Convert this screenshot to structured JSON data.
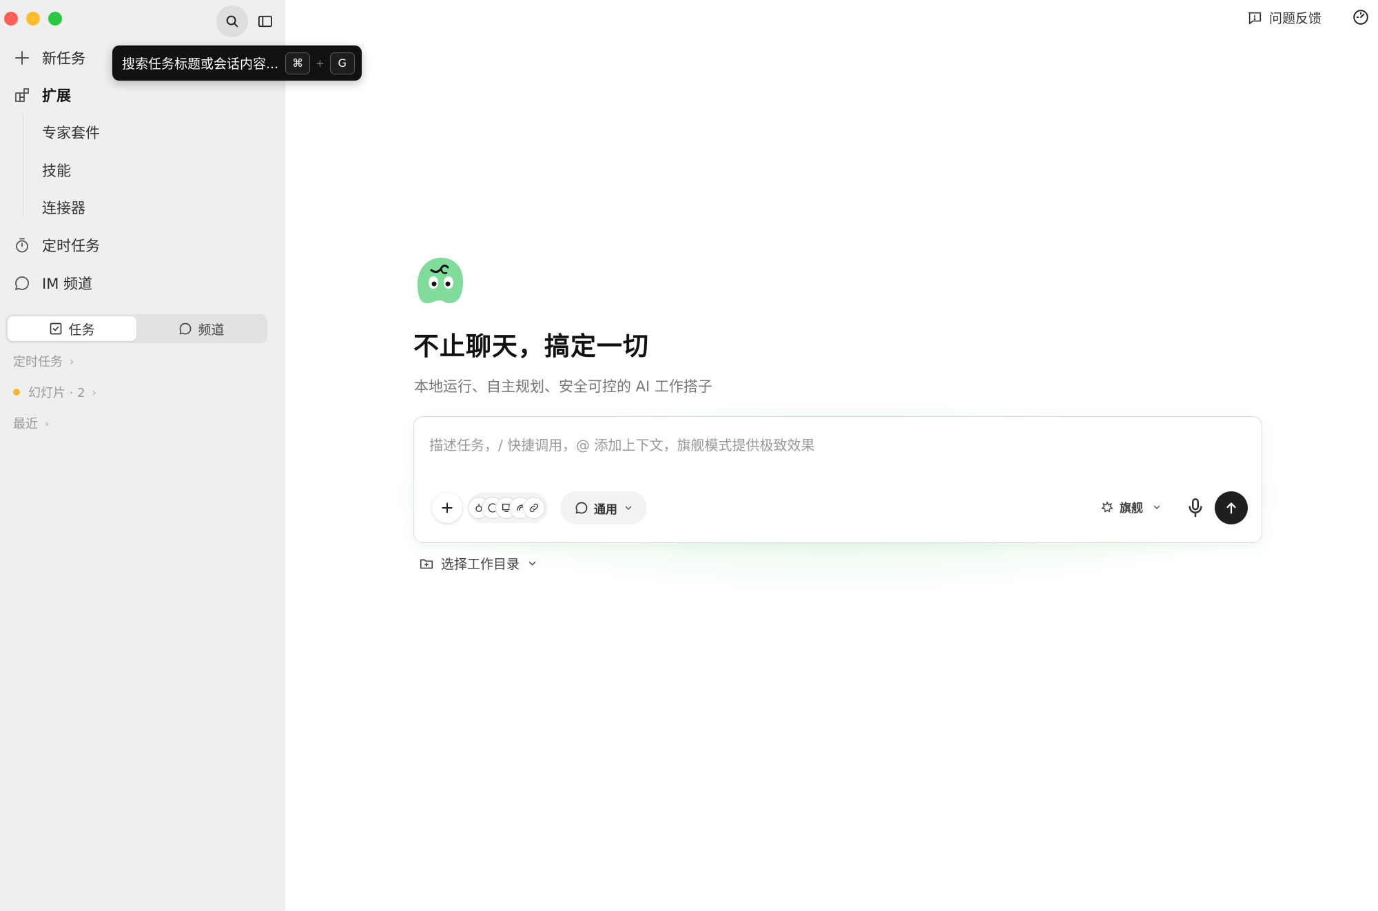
{
  "sidebar": {
    "new_task": "新任务",
    "extensions": "扩展",
    "sub_items": [
      "专家套件",
      "技能",
      "连接器"
    ],
    "scheduled": "定时任务",
    "im_channel": "IM 频道",
    "tabs": [
      {
        "label": "任务",
        "icon": "checkbox-icon",
        "active": true
      },
      {
        "label": "频道",
        "icon": "chat-bubble-icon",
        "active": false
      }
    ],
    "sections": {
      "scheduled": "定时任务",
      "slides": "幻灯片 · 2",
      "recent": "最近"
    }
  },
  "tooltip": {
    "text": "搜索任务标题或会话内容...",
    "key1": "⌘",
    "plus": "+",
    "key2": "G"
  },
  "header": {
    "feedback": "问题反馈"
  },
  "main": {
    "headline": "不止聊天，搞定一切",
    "subline": "本地运行、自主规划、安全可控的 AI 工作搭子",
    "composer": {
      "placeholder": "描述任务，/ 快捷调用，@ 添加上下文，旗舰模式提供极致效果",
      "mode": "通用",
      "model": "旗舰"
    },
    "workdir": "选择工作目录"
  },
  "colors": {
    "sidebar_bg": "#efefef",
    "mascot_green": "#7fdc9a",
    "slides_dot": "#f5b731",
    "send_button": "#1f1f1f"
  }
}
